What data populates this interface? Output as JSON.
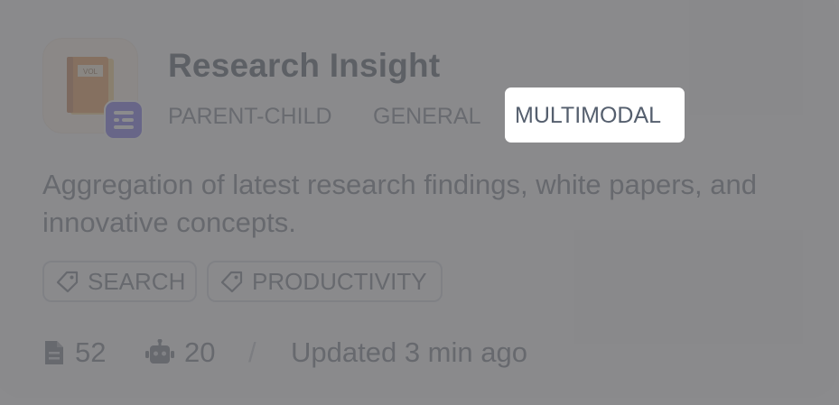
{
  "knowledge_card": {
    "title": "Research Insight",
    "app_icon": "book-icon",
    "type_badge_icon": "document-list-icon",
    "mode_tags": [
      "PARENT-CHILD",
      "GENERAL",
      "MULTIMODAL"
    ],
    "highlighted_tag": "MULTIMODAL",
    "description": "Aggregation of latest research findings, white papers, and innovative concepts.",
    "chips": [
      {
        "label": "SEARCH",
        "icon": "tag-icon"
      },
      {
        "label": "PRODUCTIVITY",
        "icon": "tag-icon"
      }
    ],
    "stats": {
      "documents": "52",
      "documents_icon": "document-icon",
      "apps": "20",
      "apps_icon": "robot-icon",
      "separator": "/",
      "updated": "Updated 3 min ago"
    },
    "colors": {
      "badge": "#4f46e5",
      "book": "#e07a1f",
      "overlay": "#6e6e70"
    }
  }
}
